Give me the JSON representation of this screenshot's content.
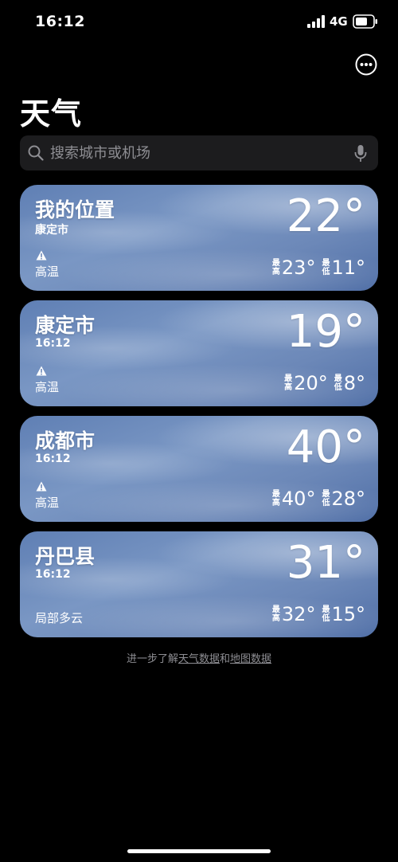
{
  "status_bar": {
    "time": "16:12",
    "network": "4G"
  },
  "header": {
    "title": "天气",
    "more_icon": "ellipsis-circle-icon"
  },
  "search": {
    "placeholder": "搜索城市或机场"
  },
  "cards": [
    {
      "name": "我的位置",
      "subtitle": "康定市",
      "condition": "高温",
      "warning": true,
      "temp": "22°",
      "high_label": "最高",
      "high": "23°",
      "low_label": "最低",
      "low": "11°"
    },
    {
      "name": "康定市",
      "subtitle": "16:12",
      "condition": "高温",
      "warning": true,
      "temp": "19°",
      "high_label": "最高",
      "high": "20°",
      "low_label": "最低",
      "low": "8°"
    },
    {
      "name": "成都市",
      "subtitle": "16:12",
      "condition": "高温",
      "warning": true,
      "temp": "40°",
      "high_label": "最高",
      "high": "40°",
      "low_label": "最低",
      "low": "28°"
    },
    {
      "name": "丹巴县",
      "subtitle": "16:12",
      "condition": "局部多云",
      "warning": false,
      "temp": "31°",
      "high_label": "最高",
      "high": "32°",
      "low_label": "最低",
      "low": "15°"
    }
  ],
  "footer": {
    "prefix": "进一步了解",
    "weather_link": "天气数据",
    "middle": "和",
    "map_link": "地图数据"
  },
  "colors": {
    "background": "#000000",
    "search_bg": "#1c1c1e",
    "placeholder": "#8e8e93",
    "card_sky": "#6c88b8"
  }
}
